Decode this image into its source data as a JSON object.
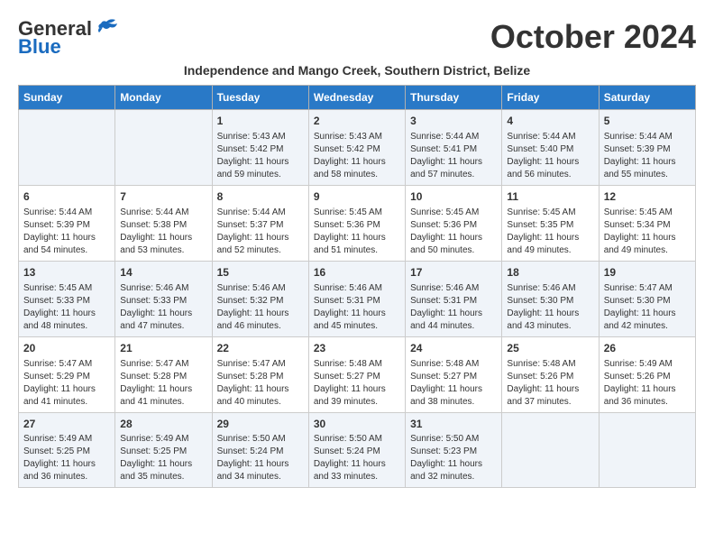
{
  "header": {
    "logo_line1": "General",
    "logo_line2": "Blue",
    "month_title": "October 2024",
    "subtitle": "Independence and Mango Creek, Southern District, Belize"
  },
  "weekdays": [
    "Sunday",
    "Monday",
    "Tuesday",
    "Wednesday",
    "Thursday",
    "Friday",
    "Saturday"
  ],
  "weeks": [
    [
      {
        "day": "",
        "detail": ""
      },
      {
        "day": "",
        "detail": ""
      },
      {
        "day": "1",
        "detail": "Sunrise: 5:43 AM\nSunset: 5:42 PM\nDaylight: 11 hours and 59 minutes."
      },
      {
        "day": "2",
        "detail": "Sunrise: 5:43 AM\nSunset: 5:42 PM\nDaylight: 11 hours and 58 minutes."
      },
      {
        "day": "3",
        "detail": "Sunrise: 5:44 AM\nSunset: 5:41 PM\nDaylight: 11 hours and 57 minutes."
      },
      {
        "day": "4",
        "detail": "Sunrise: 5:44 AM\nSunset: 5:40 PM\nDaylight: 11 hours and 56 minutes."
      },
      {
        "day": "5",
        "detail": "Sunrise: 5:44 AM\nSunset: 5:39 PM\nDaylight: 11 hours and 55 minutes."
      }
    ],
    [
      {
        "day": "6",
        "detail": "Sunrise: 5:44 AM\nSunset: 5:39 PM\nDaylight: 11 hours and 54 minutes."
      },
      {
        "day": "7",
        "detail": "Sunrise: 5:44 AM\nSunset: 5:38 PM\nDaylight: 11 hours and 53 minutes."
      },
      {
        "day": "8",
        "detail": "Sunrise: 5:44 AM\nSunset: 5:37 PM\nDaylight: 11 hours and 52 minutes."
      },
      {
        "day": "9",
        "detail": "Sunrise: 5:45 AM\nSunset: 5:36 PM\nDaylight: 11 hours and 51 minutes."
      },
      {
        "day": "10",
        "detail": "Sunrise: 5:45 AM\nSunset: 5:36 PM\nDaylight: 11 hours and 50 minutes."
      },
      {
        "day": "11",
        "detail": "Sunrise: 5:45 AM\nSunset: 5:35 PM\nDaylight: 11 hours and 49 minutes."
      },
      {
        "day": "12",
        "detail": "Sunrise: 5:45 AM\nSunset: 5:34 PM\nDaylight: 11 hours and 49 minutes."
      }
    ],
    [
      {
        "day": "13",
        "detail": "Sunrise: 5:45 AM\nSunset: 5:33 PM\nDaylight: 11 hours and 48 minutes."
      },
      {
        "day": "14",
        "detail": "Sunrise: 5:46 AM\nSunset: 5:33 PM\nDaylight: 11 hours and 47 minutes."
      },
      {
        "day": "15",
        "detail": "Sunrise: 5:46 AM\nSunset: 5:32 PM\nDaylight: 11 hours and 46 minutes."
      },
      {
        "day": "16",
        "detail": "Sunrise: 5:46 AM\nSunset: 5:31 PM\nDaylight: 11 hours and 45 minutes."
      },
      {
        "day": "17",
        "detail": "Sunrise: 5:46 AM\nSunset: 5:31 PM\nDaylight: 11 hours and 44 minutes."
      },
      {
        "day": "18",
        "detail": "Sunrise: 5:46 AM\nSunset: 5:30 PM\nDaylight: 11 hours and 43 minutes."
      },
      {
        "day": "19",
        "detail": "Sunrise: 5:47 AM\nSunset: 5:30 PM\nDaylight: 11 hours and 42 minutes."
      }
    ],
    [
      {
        "day": "20",
        "detail": "Sunrise: 5:47 AM\nSunset: 5:29 PM\nDaylight: 11 hours and 41 minutes."
      },
      {
        "day": "21",
        "detail": "Sunrise: 5:47 AM\nSunset: 5:28 PM\nDaylight: 11 hours and 41 minutes."
      },
      {
        "day": "22",
        "detail": "Sunrise: 5:47 AM\nSunset: 5:28 PM\nDaylight: 11 hours and 40 minutes."
      },
      {
        "day": "23",
        "detail": "Sunrise: 5:48 AM\nSunset: 5:27 PM\nDaylight: 11 hours and 39 minutes."
      },
      {
        "day": "24",
        "detail": "Sunrise: 5:48 AM\nSunset: 5:27 PM\nDaylight: 11 hours and 38 minutes."
      },
      {
        "day": "25",
        "detail": "Sunrise: 5:48 AM\nSunset: 5:26 PM\nDaylight: 11 hours and 37 minutes."
      },
      {
        "day": "26",
        "detail": "Sunrise: 5:49 AM\nSunset: 5:26 PM\nDaylight: 11 hours and 36 minutes."
      }
    ],
    [
      {
        "day": "27",
        "detail": "Sunrise: 5:49 AM\nSunset: 5:25 PM\nDaylight: 11 hours and 36 minutes."
      },
      {
        "day": "28",
        "detail": "Sunrise: 5:49 AM\nSunset: 5:25 PM\nDaylight: 11 hours and 35 minutes."
      },
      {
        "day": "29",
        "detail": "Sunrise: 5:50 AM\nSunset: 5:24 PM\nDaylight: 11 hours and 34 minutes."
      },
      {
        "day": "30",
        "detail": "Sunrise: 5:50 AM\nSunset: 5:24 PM\nDaylight: 11 hours and 33 minutes."
      },
      {
        "day": "31",
        "detail": "Sunrise: 5:50 AM\nSunset: 5:23 PM\nDaylight: 11 hours and 32 minutes."
      },
      {
        "day": "",
        "detail": ""
      },
      {
        "day": "",
        "detail": ""
      }
    ]
  ]
}
